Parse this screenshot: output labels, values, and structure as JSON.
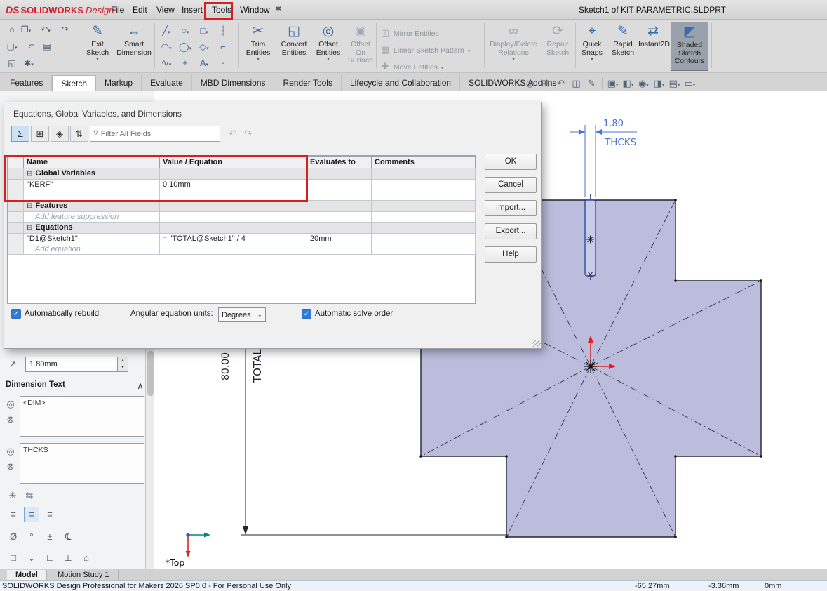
{
  "colors": {
    "annotation_red": "#d81f1f",
    "part_fill": "#b5b5d9",
    "dimension_blue": "#4a72d8",
    "selected_button_bg": "#9aa1ab"
  },
  "titlebar": {
    "brand_mark": "DS",
    "brand_name": "SOLIDWORKS",
    "brand_suffix": "Design",
    "menus": [
      "File",
      "Edit",
      "View",
      "Insert",
      "Tools",
      "Window"
    ],
    "document_title": "Sketch1 of KIT PARAMETRIC.SLDPRT"
  },
  "ribbon": {
    "exit_sketch": "Exit Sketch",
    "smart_dimension": "Smart Dimension",
    "trim_entities": "Trim Entities",
    "convert_entities": "Convert Entities",
    "offset_entities": "Offset Entities",
    "offset_on_surface": "Offset On Surface",
    "mirror_entities": "Mirror Entities",
    "linear_sketch_pattern": "Linear Sketch Pattern",
    "move_entities": "Move Entities",
    "display_delete_relations": "Display/Delete Relations",
    "repair_sketch": "Repair Sketch",
    "quick_snaps": "Quick Snaps",
    "rapid_sketch": "Rapid Sketch",
    "instant2d": "Instant2D",
    "shaded_sketch_contours": "Shaded Sketch Contours"
  },
  "tabs": [
    "Features",
    "Sketch",
    "Markup",
    "Evaluate",
    "MBD Dimensions",
    "Render Tools",
    "Lifecycle and Collaboration",
    "SOLIDWORKS Add-Ins"
  ],
  "dialog": {
    "title": "Equations, Global Variables, and Dimensions",
    "filter_placeholder": "Filter All Fields",
    "columns": [
      "Name",
      "Value / Equation",
      "Evaluates to",
      "Comments"
    ],
    "rows": [
      {
        "kind": "section",
        "name": "Global Variables"
      },
      {
        "kind": "item",
        "name": "\"KERF\"",
        "value": "0.10mm",
        "evaluates": "",
        "comments": ""
      },
      {
        "kind": "blank",
        "name": ""
      },
      {
        "kind": "section",
        "name": "Features"
      },
      {
        "kind": "placeholder",
        "name": "Add feature suppression"
      },
      {
        "kind": "section",
        "name": "Equations"
      },
      {
        "kind": "item",
        "name": "\"D1@Sketch1\"",
        "value": "= \"TOTAL@Sketch1\" / 4",
        "evaluates": "20mm",
        "comments": ""
      },
      {
        "kind": "placeholder",
        "name": "Add equation"
      }
    ],
    "buttons": [
      "OK",
      "Cancel",
      "Import...",
      "Export...",
      "Help"
    ],
    "footer": {
      "auto_rebuild": "Automatically rebuild",
      "angular_units_label": "Angular equation units:",
      "angular_units_value": "Degrees",
      "auto_solve": "Automatic solve order"
    }
  },
  "property_panel": {
    "thickness_value": "1.80mm",
    "dimension_text_header": "Dimension Text",
    "dim_text_primary": "<DIM>",
    "dim_text_secondary": "THCKS"
  },
  "viewport": {
    "dim_thcks_value": "1.80",
    "dim_thcks_label": "THCKS",
    "dim_total_value": "80.00",
    "dim_total_label": "TOTAL",
    "orientation_label": "*Top"
  },
  "sheet_tabs": [
    "Model",
    "Motion Study 1"
  ],
  "statusbar": {
    "message": "SOLIDWORKS Design Professional for Makers 2026 SP0.0 - For Personal Use Only",
    "coord_x": "-65.27mm",
    "coord_y": "-3.36mm",
    "coord_z": "0mm"
  },
  "icons": {
    "caret": "▾",
    "caret_up": "∧",
    "pin": "✱",
    "home": "⌂",
    "save": "❒",
    "undo": "↶",
    "redo": "↷",
    "new_doc": "▢",
    "attach": "⊂",
    "print": "▤",
    "share": "◱",
    "options_gear": "✱",
    "exit_sketch": "✎",
    "smart_dimension": "↔",
    "line": "╱",
    "circle": "○",
    "rectangle": "□",
    "centerline": "┆",
    "arc": "◠",
    "ellipse": "◯",
    "polygon": "◇",
    "fillet": "⌐",
    "spline": "∿",
    "point": "+",
    "text": "A",
    "dot": "·",
    "trim": "✂",
    "convert": "◱",
    "offset": "◎",
    "offset_surface": "◉",
    "mirror": "◫",
    "linear_pattern": "▦",
    "move": "✚",
    "relations": "∞",
    "repair": "⟳",
    "quick_snaps": "⌖",
    "rapid_sketch": "✎",
    "instant2d": "⇄",
    "shaded_contours": "◩",
    "sigma": "Σ",
    "dim_view": "⊞",
    "ordered_view": "◈",
    "sort": "⇅",
    "filter": "∇",
    "collapse": "⊟",
    "check": "✓",
    "thickness": "↗",
    "witness": "◎",
    "no_witness": "⊗",
    "asterisk": "✳",
    "swap": "⇆",
    "align": "≡",
    "diameter": "Ø",
    "degree": "°",
    "plus_minus": "±",
    "centerline_symbol": "℄",
    "square": "□",
    "chevron_down": "⌄",
    "angle": "∟",
    "perpendicular": "⊥",
    "spin_up": "▴",
    "spin_down": "▾",
    "zoom_fit": "◎",
    "zoom_area": "⊞",
    "prev_view": "↶",
    "section_view": "◫",
    "sketch_visibility": "✎",
    "view_orientation": "▣",
    "display_style": "◧",
    "hide_show": "◉",
    "appearance": "◨",
    "scene": "▤",
    "view_settings": "▭"
  }
}
